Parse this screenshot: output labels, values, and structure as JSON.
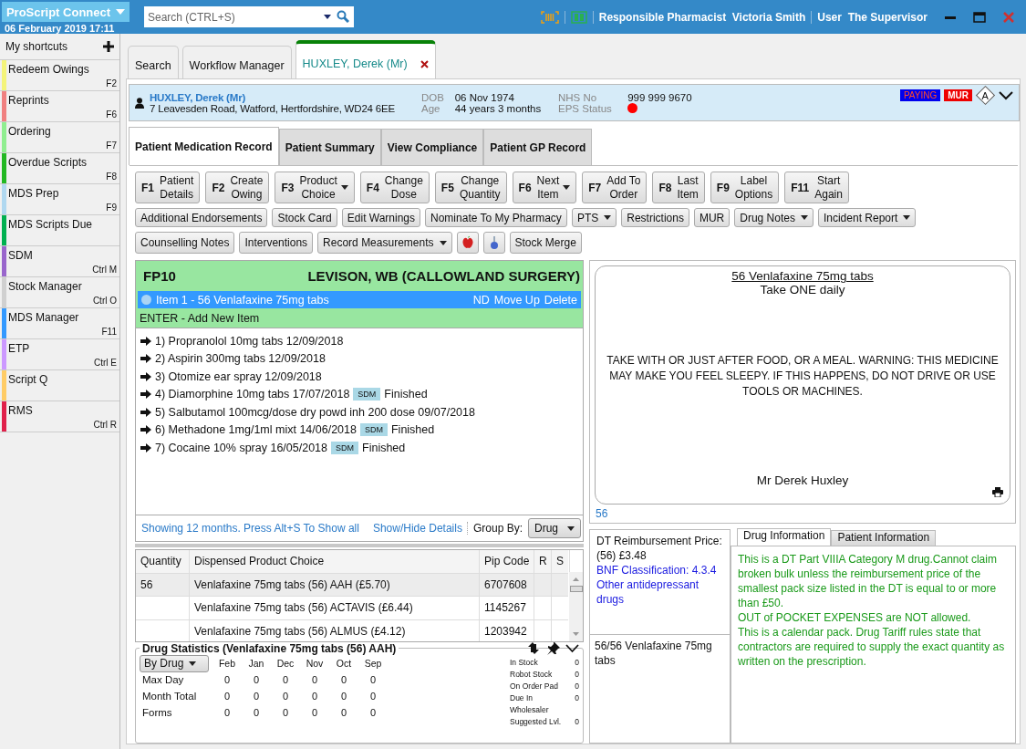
{
  "app": {
    "title": "ProScript Connect",
    "datetime": "06 February 2019 17:11"
  },
  "search": {
    "placeholder": "Search (CTRL+S)"
  },
  "status": {
    "pharmacist": "Responsible Pharmacist  Victoria Smith",
    "user": "User  The Supervisor"
  },
  "sidebar": {
    "title": "My shortcuts",
    "items": [
      {
        "label": "Redeem Owings",
        "shortcut": "F2",
        "color": "#f4f47a"
      },
      {
        "label": "Reprints",
        "shortcut": "F6",
        "color": "#f08080"
      },
      {
        "label": "Ordering",
        "shortcut": "F7",
        "color": "#90ee90"
      },
      {
        "label": "Overdue Scripts",
        "shortcut": "F8",
        "color": "#22b822"
      },
      {
        "label": "MDS Prep",
        "shortcut": "F9",
        "color": "#b0d8f0"
      },
      {
        "label": "MDS Scripts Due",
        "color": "#00b050"
      },
      {
        "label": "SDM",
        "shortcut": "Ctrl M",
        "color": "#9966cc"
      },
      {
        "label": "Stock Manager",
        "shortcut": "Ctrl O",
        "color": "#d0d0d0"
      },
      {
        "label": "MDS Manager",
        "shortcut": "F11",
        "color": "#3399ff"
      },
      {
        "label": "ETP",
        "shortcut": "Ctrl E",
        "color": "#cc99ff"
      },
      {
        "label": "Script Q",
        "color": "#ffcc66"
      },
      {
        "label": "RMS",
        "shortcut": "Ctrl R",
        "color": "#e0204a"
      }
    ]
  },
  "tabs": [
    {
      "label": "Search",
      "selected": false,
      "closable": false
    },
    {
      "label": "Workflow Manager",
      "selected": false,
      "closable": false
    },
    {
      "label": "HUXLEY, Derek (Mr)",
      "selected": true,
      "closable": true
    }
  ],
  "patient": {
    "name": "HUXLEY, Derek (Mr)",
    "address": "7 Leavesden Road, Watford, Hertfordshire, WD24 6EE",
    "dob_label": "DOB",
    "dob": "06 Nov 1974",
    "age_label": "Age",
    "age": "44 years 3 months",
    "nhs_label": "NHS No",
    "nhs": "999 999 9670",
    "eps_label": "EPS Status",
    "flags": [
      {
        "label": "PAYING",
        "kind": "paying"
      },
      {
        "label": "MUR",
        "kind": "mur"
      }
    ],
    "marker": "A"
  },
  "record_tabs": [
    {
      "label": "Patient Medication Record",
      "selected": true
    },
    {
      "label": "Patient Summary",
      "selected": false
    },
    {
      "label": "View Compliance",
      "selected": false
    },
    {
      "label": "Patient GP Record",
      "selected": false
    }
  ],
  "function_buttons": [
    {
      "key": "F1",
      "lines": [
        "Patient",
        "Details"
      ],
      "dropdown": false
    },
    {
      "key": "F2",
      "lines": [
        "Create",
        "Owing"
      ],
      "dropdown": false
    },
    {
      "key": "F3",
      "lines": [
        "Product",
        "Choice"
      ],
      "dropdown": true
    },
    {
      "key": "F4",
      "lines": [
        "Change",
        "Dose"
      ],
      "dropdown": false
    },
    {
      "key": "F5",
      "lines": [
        "Change",
        "Quantity"
      ],
      "dropdown": false
    },
    {
      "key": "F6",
      "lines": [
        "Next",
        "Item"
      ],
      "dropdown": true
    },
    {
      "key": "F7",
      "lines": [
        "Add To",
        "Order"
      ],
      "dropdown": false
    },
    {
      "key": "F8",
      "lines": [
        "Last",
        "Item"
      ],
      "dropdown": false
    },
    {
      "key": "F9",
      "lines": [
        "Label",
        "Options"
      ],
      "dropdown": false
    },
    {
      "key": "F11",
      "lines": [
        "Start",
        "Again"
      ],
      "dropdown": false
    }
  ],
  "action_rows": [
    [
      {
        "kind": "text",
        "label": "Additional Endorsements",
        "dropdown": false
      },
      {
        "kind": "text",
        "label": "Stock Card",
        "dropdown": false
      },
      {
        "kind": "text",
        "label": "Edit Warnings",
        "dropdown": false
      },
      {
        "kind": "text",
        "label": "Nominate To My Pharmacy",
        "dropdown": false
      },
      {
        "kind": "text",
        "label": "PTS",
        "dropdown": true
      },
      {
        "kind": "text",
        "label": "Restrictions",
        "dropdown": false
      },
      {
        "kind": "text",
        "label": "MUR",
        "dropdown": false
      },
      {
        "kind": "text",
        "label": "Drug Notes",
        "dropdown": true
      },
      {
        "kind": "text",
        "label": "Incident Report",
        "dropdown": true
      }
    ],
    [
      {
        "kind": "text",
        "label": "Counselling Notes",
        "dropdown": false
      },
      {
        "kind": "text",
        "label": "Interventions",
        "dropdown": false
      },
      {
        "kind": "text",
        "label": "Record Measurements",
        "dropdown": true
      },
      {
        "kind": "apple"
      },
      {
        "kind": "flask"
      },
      {
        "kind": "text",
        "label": "Stock Merge",
        "dropdown": false
      }
    ]
  ],
  "prescription": {
    "form": "FP10",
    "prescriber": "LEVISON, WB (CALLOWLAND SURGERY)",
    "current_item": "Item 1 - 56 Venlafaxine 75mg tabs",
    "item_actions": [
      "ND",
      "Move Up",
      "Delete"
    ],
    "add_hint": "ENTER - Add New Item"
  },
  "history": [
    {
      "text": "1) Propranolol 10mg tabs 12/09/2018"
    },
    {
      "text": "2) Aspirin 300mg tabs 12/09/2018"
    },
    {
      "text": "3) Otomize ear spray 12/09/2018"
    },
    {
      "text": "4) Diamorphine 10mg tabs 17/07/2018",
      "badge": "SDM",
      "status": "Finished"
    },
    {
      "text": "5) Salbutamol 100mcg/dose dry powd inh 200 dose 09/07/2018"
    },
    {
      "text": "6) Methadone 1mg/1ml mixt 14/06/2018",
      "badge": "SDM",
      "status": "Finished"
    },
    {
      "text": "7) Cocaine 10% spray 16/05/2018",
      "badge": "SDM",
      "status": "Finished"
    }
  ],
  "history_footer": {
    "range": "Showing 12 months. Press Alt+S To Show all",
    "toggle": "Show/Hide Details",
    "group_label": "Group By:",
    "group_value": "Drug"
  },
  "products": {
    "columns": [
      "Quantity",
      "Dispensed Product Choice",
      "Pip Code",
      "R",
      "S"
    ],
    "rows": [
      {
        "cells": [
          "56",
          "Venlafaxine 75mg tabs (56) AAH (£5.70)",
          "6707608",
          "",
          ""
        ],
        "selected": true
      },
      {
        "cells": [
          "",
          "Venlafaxine 75mg tabs (56) ACTAVIS (£6.44)",
          "1145267",
          "",
          ""
        ],
        "selected": false
      },
      {
        "cells": [
          "",
          "Venlafaxine 75mg tabs (56) ALMUS (£4.12)",
          "1203942",
          "",
          ""
        ],
        "selected": false
      }
    ]
  },
  "drug_stats": {
    "title": "Drug Statistics (Venlafaxine 75mg tabs (56) AAH)",
    "mode": "By Drug",
    "months": [
      "Feb",
      "Jan",
      "Dec",
      "Nov",
      "Oct",
      "Sep"
    ],
    "rows": [
      {
        "label": "Max Day",
        "values": [
          "0",
          "0",
          "0",
          "0",
          "0",
          "0"
        ]
      },
      {
        "label": "Month Total",
        "values": [
          "0",
          "0",
          "0",
          "0",
          "0",
          "0"
        ]
      },
      {
        "label": "Forms",
        "values": [
          "0",
          "0",
          "0",
          "0",
          "0",
          "0"
        ]
      }
    ],
    "stock": [
      {
        "label": "In Stock",
        "value": "0"
      },
      {
        "label": "Robot Stock",
        "value": "0"
      },
      {
        "label": "On Order Pad",
        "value": "0"
      },
      {
        "label": "Due In Wholesaler",
        "value": "0"
      },
      {
        "label": "Suggested Lvl.",
        "value": "0"
      }
    ]
  },
  "label_preview": {
    "drug": "56 Venlafaxine 75mg tabs",
    "dose": "Take ONE daily",
    "warning": "TAKE WITH OR JUST AFTER FOOD, OR A MEAL. WARNING: THIS MEDICINE MAY MAKE YOU FEEL SLEEPY. IF THIS HAPPENS, DO NOT DRIVE OR USE TOOLS OR MACHINES.",
    "patient": "Mr Derek Huxley"
  },
  "label_quantity": "56",
  "pricing": {
    "reimbursement": "DT Reimbursement Price: (56) £3.48",
    "bnf": "BNF Classification: 4.3.4 Other antidepressant drugs"
  },
  "stock_summary": "56/56 Venlafaxine 75mg tabs",
  "info_tabs": [
    {
      "label": "Drug Information",
      "selected": true
    },
    {
      "label": "Patient Information",
      "selected": false
    }
  ],
  "info_text": [
    "This is a DT Part VIIIA Category M drug.Cannot claim broken bulk unless the reimbursement price of the smallest pack size listed in the DT is equal to or more than £50.",
    "OUT of POCKET EXPENSES are NOT allowed.",
    "This is a calendar pack. Drug Tariff rules state that contractors are required to supply the exact quantity as written on the prescription."
  ]
}
